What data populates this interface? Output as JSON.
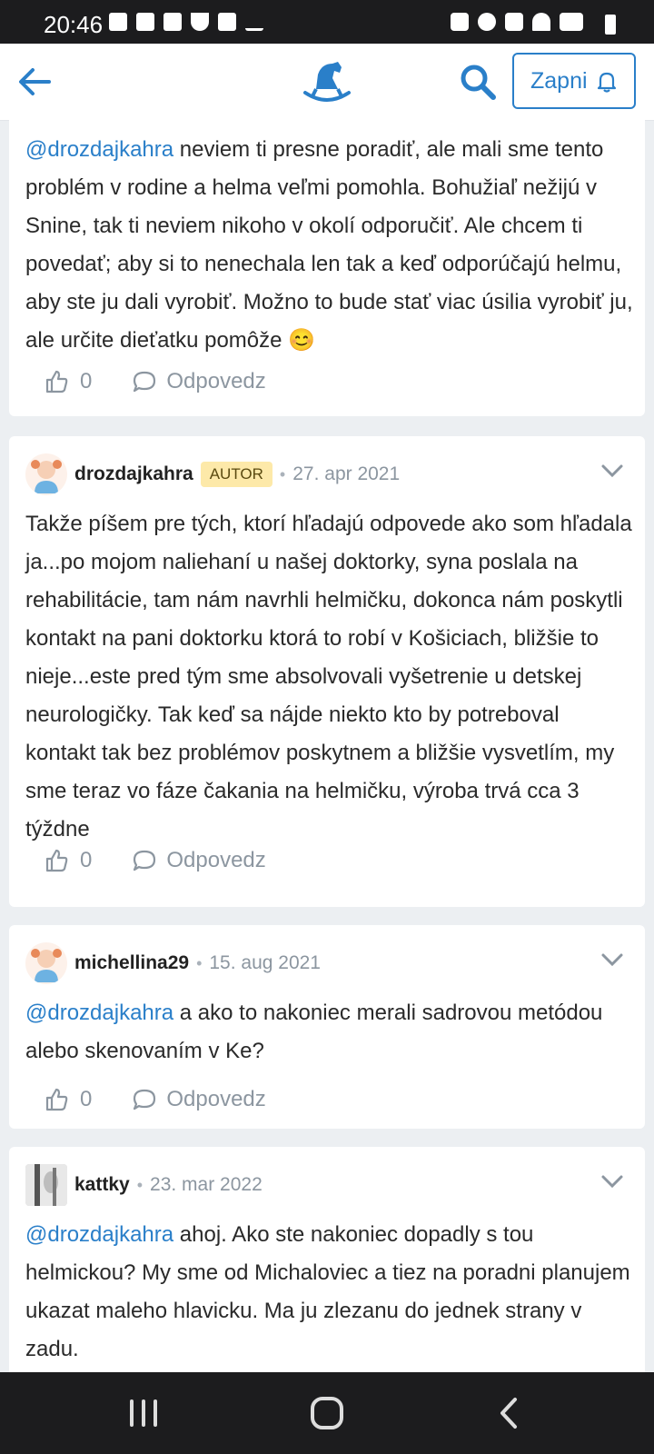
{
  "status_bar": {
    "time": "20:46",
    "left_icons": [
      "h-icon",
      "m-icon",
      "camera-icon",
      "shield-icon",
      "image-icon",
      "check-icon"
    ],
    "right_icons": [
      "recycle-icon",
      "alarm-icon",
      "mute-icon",
      "wifi-icon",
      "volte-icon",
      "signal-icon",
      "battery-icon"
    ]
  },
  "app_bar": {
    "notify_button_label": "Zapni",
    "accent": "#2a7fc9"
  },
  "posts": [
    {
      "mention": "@drozdajkahra",
      "text": " neviem ti presne poradiť, ale mali sme tento problém v rodine a helma veľmi pomohla. Bohužiaľ nežijú v Snine, tak ti neviem nikoho v okolí odporučiť. Ale chcem ti povedať; aby si to nenechala len tak a keď odporúčajú helmu, aby ste ju dali vyrobiť. Možno to bude stať viac úsilia vyrobiť ju, ale určite dieťatku pomôže 😊",
      "likes": "0",
      "reply_label": "Odpovedz"
    },
    {
      "user": "drozdajkahra",
      "badge": "AUTOR",
      "date": "27. apr 2021",
      "text": "Takže píšem pre tých, ktorí hľadajú odpovede ako som hľadala ja...po mojom naliehaní u našej doktorky, syna poslala na rehabilitácie, tam nám navrhli helmičku, dokonca nám poskytli kontakt na pani doktorku ktorá to robí v Košiciach, bližšie to nieje...este pred tým sme absolvovali vyšetrenie u detskej neurologičky. Tak keď sa nájde niekto kto by potreboval kontakt tak bez problémov poskytnem a bližšie vysvetlím, my sme teraz vo fáze čakania na helmičku, výroba trvá cca 3 týždne",
      "likes": "0",
      "reply_label": "Odpovedz"
    },
    {
      "user": "michellina29",
      "date": "15. aug 2021",
      "mention": "@drozdajkahra",
      "text": " a ako to nakoniec merali sadrovou metódou alebo skenovaním v Ke?",
      "likes": "0",
      "reply_label": "Odpovedz"
    },
    {
      "user": "kattky",
      "date": "23. mar 2022",
      "mention": "@drozdajkahra",
      "text": " ahoj. Ako ste nakoniec dopadly s tou helmickou? My sme od Michaloviec a tiez na poradni planujem ukazat maleho hlavicku. Ma ju zlezanu do jednek strany v zadu."
    }
  ],
  "separator": "•"
}
